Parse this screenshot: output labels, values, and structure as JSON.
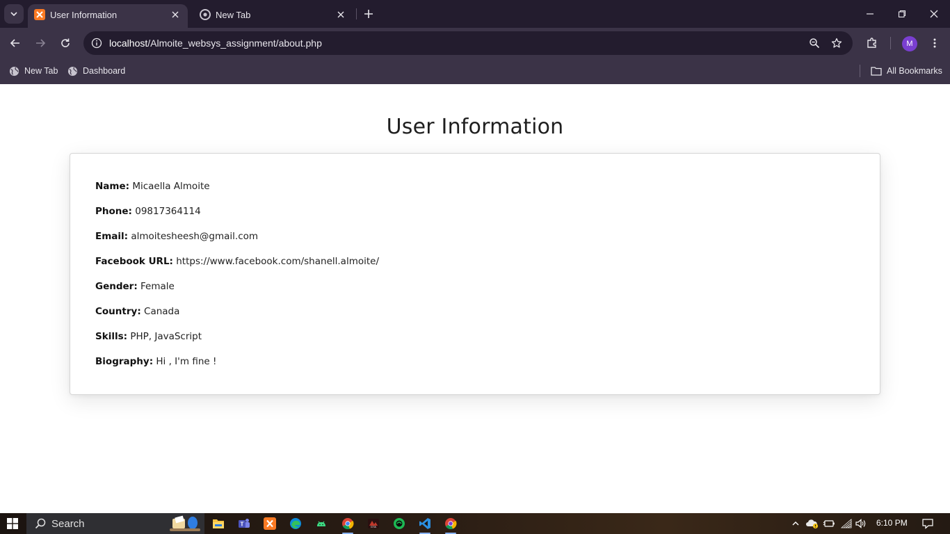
{
  "browser": {
    "tabs": [
      {
        "title": "User Information",
        "active": true,
        "icon": "xampp-icon"
      },
      {
        "title": "New Tab",
        "active": false,
        "icon": "chrome-icon"
      }
    ],
    "address_bar": {
      "host": "localhost",
      "path": "/Almoite_websys_assignment/about.php"
    },
    "profile_initial": "M",
    "bookmarks": [
      {
        "label": "New Tab",
        "icon": "globe-icon"
      },
      {
        "label": "Dashboard",
        "icon": "globe-icon"
      }
    ],
    "all_bookmarks_label": "All Bookmarks"
  },
  "page": {
    "heading": "User Information",
    "fields": [
      {
        "label": "Name:",
        "value": "Micaella Almoite"
      },
      {
        "label": "Phone:",
        "value": "09817364114"
      },
      {
        "label": "Email:",
        "value": "almoitesheesh@gmail.com"
      },
      {
        "label": "Facebook URL:",
        "value": "https://www.facebook.com/shanell.almoite/"
      },
      {
        "label": "Gender:",
        "value": "Female"
      },
      {
        "label": "Country:",
        "value": "Canada"
      },
      {
        "label": "Skills:",
        "value": "PHP, JavaScript"
      },
      {
        "label": "Biography:",
        "value": "Hi , I'm fine !"
      }
    ]
  },
  "taskbar": {
    "search_label": "Search",
    "clock": "6:10 PM",
    "apps": [
      "file-explorer-icon",
      "teams-icon",
      "xampp-icon",
      "edge-icon",
      "android-studio-icon",
      "chrome-icon",
      "game-icon",
      "green-app-icon",
      "vscode-icon",
      "chrome-alt-icon"
    ]
  },
  "colors": {
    "tab_strip": "#231c2e",
    "toolbar": "#3b3347",
    "accent_profile": "#7a3fd1"
  }
}
